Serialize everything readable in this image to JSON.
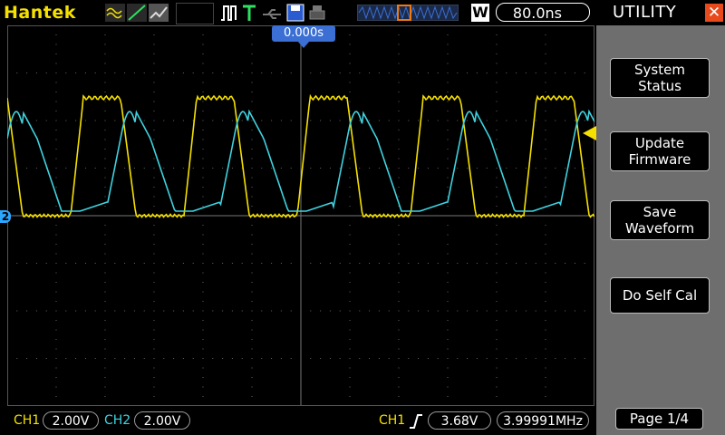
{
  "header": {
    "brand": "Hantek",
    "w_label": "W",
    "timebase": "80.0ns",
    "trigger_position": "0.000s"
  },
  "panel": {
    "title": "UTILITY",
    "items": [
      {
        "line1": "System",
        "line2": "Status"
      },
      {
        "line1": "Update",
        "line2": "Firmware"
      },
      {
        "line1": "Save",
        "line2": "Waveform"
      },
      {
        "line1": "Do Self Cal",
        "line2": ""
      }
    ],
    "page": "Page 1/4"
  },
  "status": {
    "ch1_label": "CH1",
    "ch1_scale": "2.00V",
    "ch2_label": "CH2",
    "ch2_scale": "2.00V",
    "trig_source": "CH1",
    "trig_level": "3.68V",
    "frequency": "3.99991MHz"
  },
  "channel_marker": "2",
  "colors": {
    "ch1": "#f5e000",
    "ch2": "#3fd3e0",
    "panel_bg": "#6e6e6e",
    "close": "#e84a1c",
    "trigger_marker": "#3b6fd4"
  },
  "icons": [
    "waveform-mode-icons",
    "trigger-pulse-icon",
    "trigger-T-icon",
    "usb-icon",
    "save-disk-icon",
    "printer-icon",
    "memory-depth-icon",
    "close-icon",
    "trigger-level-arrow-icon",
    "rising-edge-icon"
  ]
}
